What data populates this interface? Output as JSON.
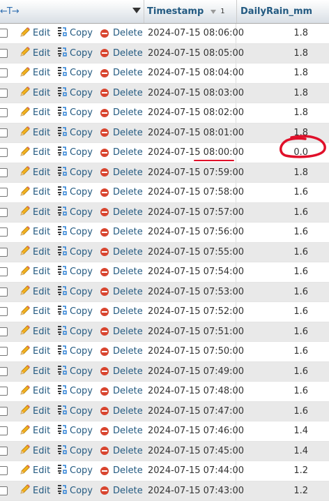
{
  "header": {
    "actions_arrows": "←T→",
    "timestamp_label": "Timestamp",
    "sort_index": "1",
    "rain_label": "DailyRain_mm"
  },
  "actions": {
    "edit": "Edit",
    "copy": "Copy",
    "delete": "Delete"
  },
  "rows": [
    {
      "timestamp": "2024-07-15 08:06:00",
      "rain": "1.8"
    },
    {
      "timestamp": "2024-07-15 08:05:00",
      "rain": "1.8"
    },
    {
      "timestamp": "2024-07-15 08:04:00",
      "rain": "1.8"
    },
    {
      "timestamp": "2024-07-15 08:03:00",
      "rain": "1.8"
    },
    {
      "timestamp": "2024-07-15 08:02:00",
      "rain": "1.8"
    },
    {
      "timestamp": "2024-07-15 08:01:00",
      "rain": "1.8"
    },
    {
      "timestamp": "2024-07-15 08:00:00",
      "rain": "0.0"
    },
    {
      "timestamp": "2024-07-15 07:59:00",
      "rain": "1.8"
    },
    {
      "timestamp": "2024-07-15 07:58:00",
      "rain": "1.6"
    },
    {
      "timestamp": "2024-07-15 07:57:00",
      "rain": "1.6"
    },
    {
      "timestamp": "2024-07-15 07:56:00",
      "rain": "1.6"
    },
    {
      "timestamp": "2024-07-15 07:55:00",
      "rain": "1.6"
    },
    {
      "timestamp": "2024-07-15 07:54:00",
      "rain": "1.6"
    },
    {
      "timestamp": "2024-07-15 07:53:00",
      "rain": "1.6"
    },
    {
      "timestamp": "2024-07-15 07:52:00",
      "rain": "1.6"
    },
    {
      "timestamp": "2024-07-15 07:51:00",
      "rain": "1.6"
    },
    {
      "timestamp": "2024-07-15 07:50:00",
      "rain": "1.6"
    },
    {
      "timestamp": "2024-07-15 07:49:00",
      "rain": "1.6"
    },
    {
      "timestamp": "2024-07-15 07:48:00",
      "rain": "1.6"
    },
    {
      "timestamp": "2024-07-15 07:47:00",
      "rain": "1.6"
    },
    {
      "timestamp": "2024-07-15 07:46:00",
      "rain": "1.4"
    },
    {
      "timestamp": "2024-07-15 07:45:00",
      "rain": "1.4"
    },
    {
      "timestamp": "2024-07-15 07:44:00",
      "rain": "1.2"
    },
    {
      "timestamp": "2024-07-15 07:43:00",
      "rain": "1.2"
    }
  ],
  "annotation": {
    "highlight_color": "#e0102a"
  }
}
